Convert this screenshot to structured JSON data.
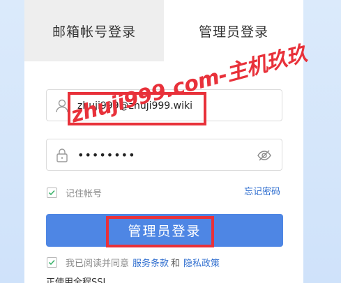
{
  "tabs": {
    "email_login": "邮箱帐号登录",
    "admin_login": "管理员登录"
  },
  "username": {
    "value": "zhuji999@zhuji999.wiki"
  },
  "password": {
    "value": "••••••••"
  },
  "remember": {
    "label": "记住帐号",
    "checked": true
  },
  "forgot_password": "忘记密码",
  "login_button": "管理员登录",
  "agreement": {
    "prefix": "我已阅读并同意",
    "terms": "服务条款",
    "and": "和",
    "privacy": "隐私政策",
    "checked": true
  },
  "bottom_text": "正使用全程SSL",
  "watermark": "zhuji999.com-主机玖玖",
  "colors": {
    "accent": "#4e86e4",
    "link": "#2f6ecf",
    "highlight_red": "#e8313a",
    "check_green": "#3bb36a"
  },
  "icons": {
    "username": "user-icon",
    "password": "lock-icon",
    "visibility": "eye-off-icon"
  }
}
